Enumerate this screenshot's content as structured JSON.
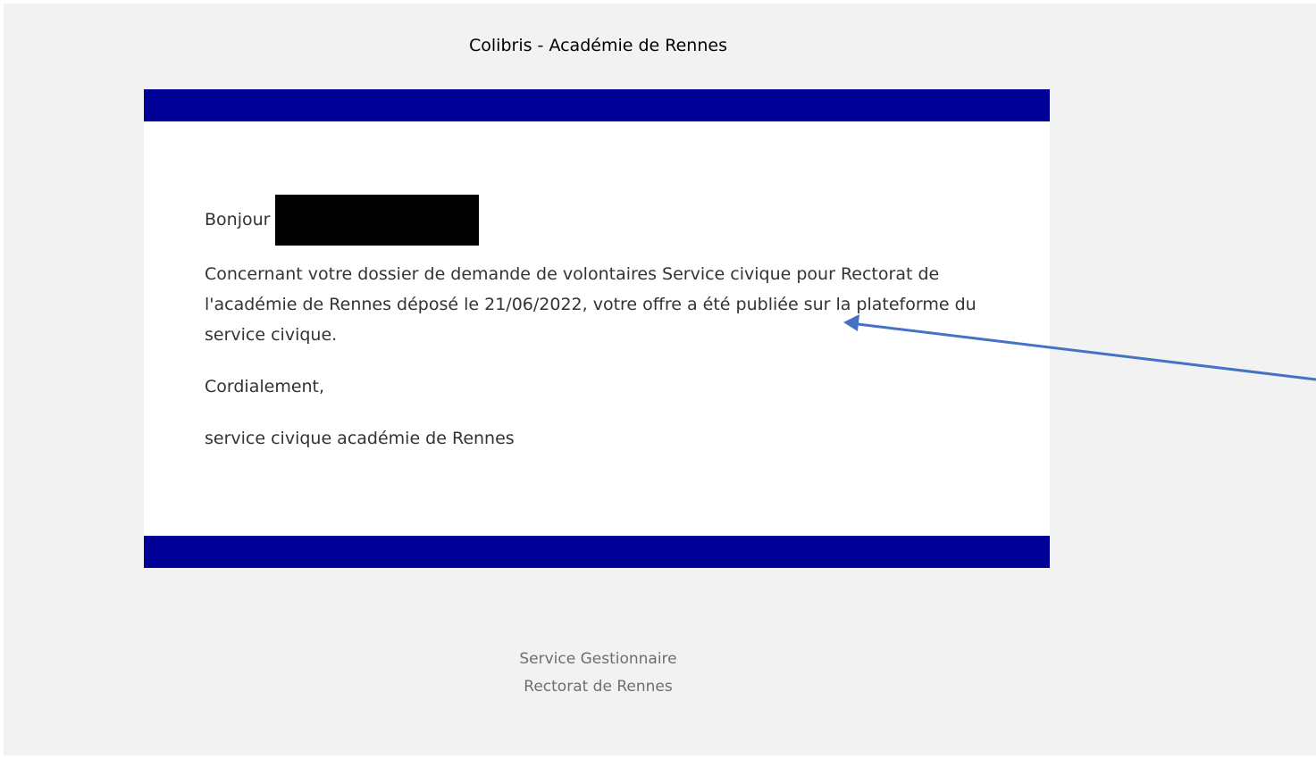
{
  "email": {
    "title": "Colibris - Académie de Rennes",
    "greeting": "Bonjour",
    "message": "Concernant votre dossier de demande de volontaires Service civique pour Rectorat de l'académie de Rennes déposé le 21/06/2022, votre offre a été publiée sur la plateforme du service civique.",
    "closing": "Cordialement,",
    "signature": "service civique académie de Rennes"
  },
  "footer": {
    "line1": "Service Gestionnaire",
    "line2": "Rectorat de Rennes"
  },
  "colors": {
    "page_background": "#f2f2f2",
    "band": "#000096",
    "arrow": "#4472c4",
    "text": "#333333",
    "footer_text": "#6e6e6e"
  }
}
